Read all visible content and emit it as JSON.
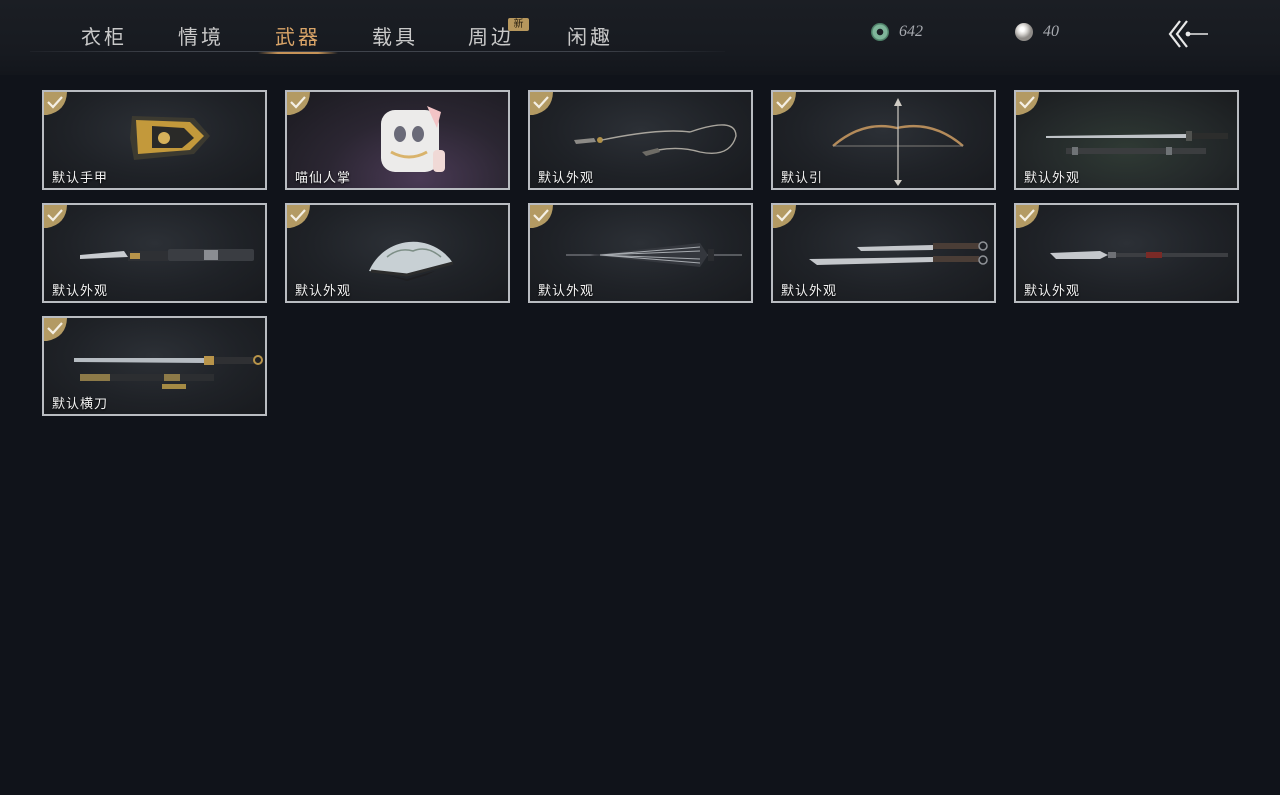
{
  "tabs": [
    {
      "label": "衣柜",
      "active": false
    },
    {
      "label": "情境",
      "active": false
    },
    {
      "label": "武器",
      "active": true
    },
    {
      "label": "载具",
      "active": false
    },
    {
      "label": "周边",
      "active": false
    },
    {
      "label": "闲趣",
      "active": false
    }
  ],
  "new_badge": "新",
  "currency": {
    "jade": "642",
    "pearl": "40"
  },
  "items": [
    {
      "label": "默认手甲",
      "icon": "gauntlet-icon",
      "equipped": true
    },
    {
      "label": "喵仙人掌",
      "icon": "cat-paw-glove-icon",
      "equipped": true
    },
    {
      "label": "默认外观",
      "icon": "rope-dart-icon",
      "equipped": true
    },
    {
      "label": "默认引",
      "icon": "bow-icon",
      "equipped": true
    },
    {
      "label": "默认外观",
      "icon": "sword-and-scabbard-icon",
      "equipped": true
    },
    {
      "label": "默认外观",
      "icon": "dagger-icon",
      "equipped": true
    },
    {
      "label": "默认外观",
      "icon": "folding-fan-icon",
      "equipped": true
    },
    {
      "label": "默认外观",
      "icon": "umbrella-icon",
      "equipped": true
    },
    {
      "label": "默认外观",
      "icon": "twin-blades-icon",
      "equipped": true
    },
    {
      "label": "默认外观",
      "icon": "glaive-icon",
      "equipped": true
    },
    {
      "label": "默认横刀",
      "icon": "hengdao-sabre-icon",
      "equipped": true
    }
  ],
  "colors": {
    "accent": "#d9a468",
    "check_badge": "#b39a63",
    "card_border": "#b9bcc1",
    "background": "#10131a"
  }
}
